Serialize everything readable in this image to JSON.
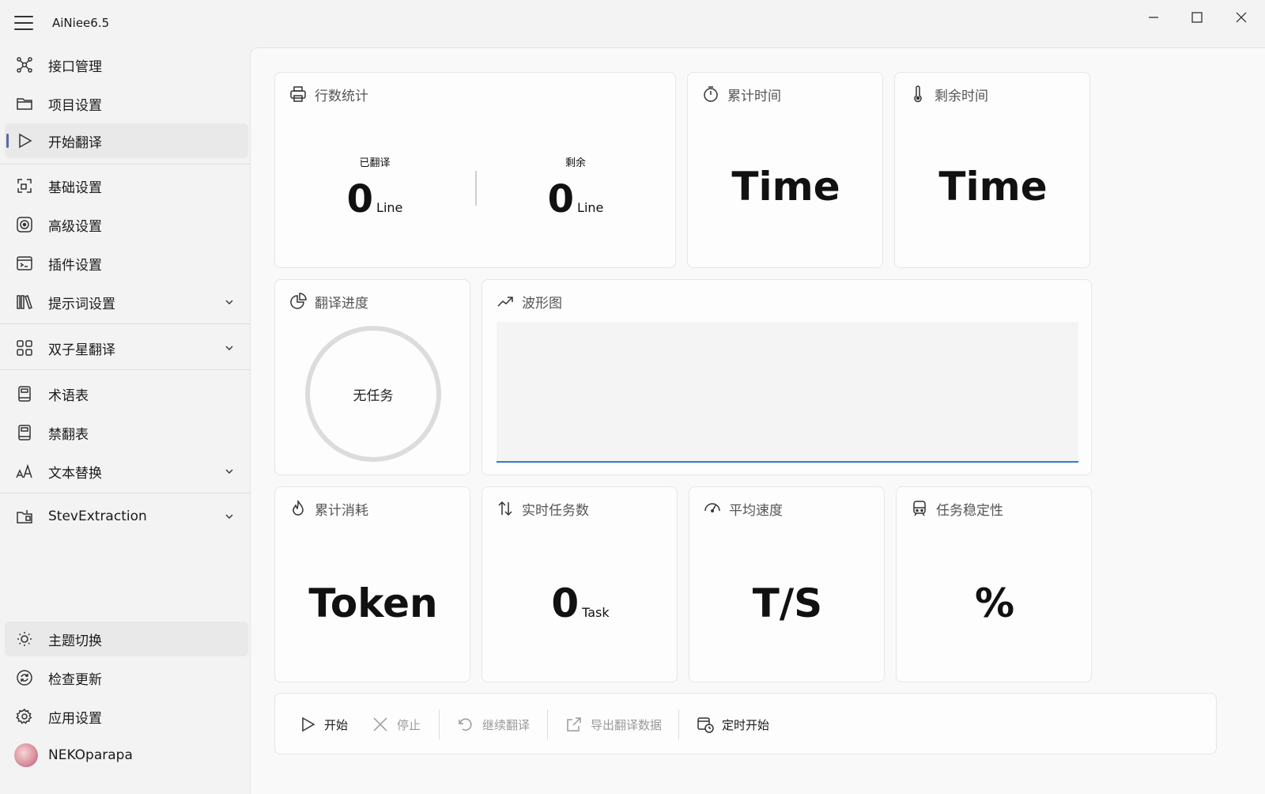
{
  "app": {
    "title": "AiNiee6.5"
  },
  "sidebar": {
    "items": [
      {
        "label": "接口管理",
        "icon": "network-icon"
      },
      {
        "label": "项目设置",
        "icon": "folder-icon"
      },
      {
        "label": "开始翻译",
        "icon": "play-icon",
        "selected": true
      },
      {
        "label": "基础设置",
        "icon": "frame-icon"
      },
      {
        "label": "高级设置",
        "icon": "target-icon"
      },
      {
        "label": "插件设置",
        "icon": "console-icon"
      },
      {
        "label": "提示词设置",
        "icon": "library-icon",
        "expandable": true
      },
      {
        "label": "双子星翻译",
        "icon": "grid-icon",
        "expandable": true
      },
      {
        "label": "术语表",
        "icon": "book-icon"
      },
      {
        "label": "禁翻表",
        "icon": "book-icon"
      },
      {
        "label": "文本替换",
        "icon": "font-size-icon",
        "expandable": true
      },
      {
        "label": "StevExtraction",
        "icon": "extract-icon",
        "expandable": true
      }
    ],
    "bottom": [
      {
        "label": "主题切换",
        "icon": "brightness-icon"
      },
      {
        "label": "检查更新",
        "icon": "sync-icon"
      },
      {
        "label": "应用设置",
        "icon": "gear-icon"
      }
    ],
    "user": {
      "name": "NEKOparapa"
    }
  },
  "cards": {
    "line_stats": {
      "title": "行数统计",
      "translated_label": "已翻译",
      "translated_value": "0",
      "remaining_label": "剩余",
      "remaining_value": "0",
      "unit": "Line"
    },
    "elapsed": {
      "title": "累计时间",
      "value": "Time"
    },
    "remaining": {
      "title": "剩余时间",
      "value": "Time"
    },
    "progress": {
      "title": "翻译进度",
      "status": "无任务"
    },
    "wave": {
      "title": "波形图"
    },
    "tokens": {
      "title": "累计消耗",
      "value": "Token"
    },
    "tasks": {
      "title": "实时任务数",
      "value": "0",
      "unit": "Task"
    },
    "speed": {
      "title": "平均速度",
      "value": "T/S"
    },
    "stability": {
      "title": "任务稳定性",
      "value": "%"
    }
  },
  "toolbar": {
    "start": "开始",
    "stop": "停止",
    "continue": "继续翻译",
    "export": "导出翻译数据",
    "timer": "定时开始"
  },
  "colors": {
    "accent": "#2f7bd4",
    "selected_indicator": "#5a6aa0"
  }
}
